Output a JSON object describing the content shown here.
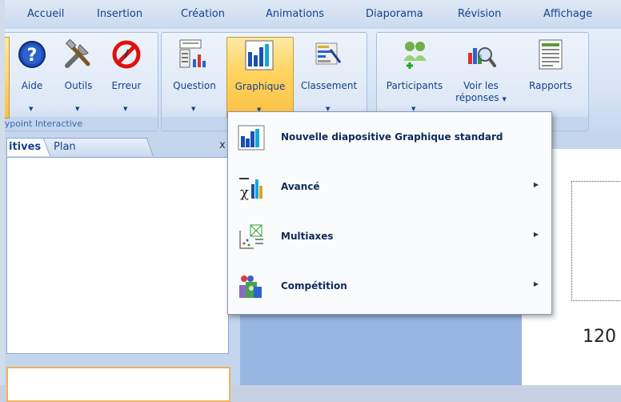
{
  "tabs": [
    "Accueil",
    "Insertion",
    "Création",
    "Animations",
    "Diaporama",
    "Révision",
    "Affichage"
  ],
  "ribbon": {
    "group1": {
      "label": "eypoint Interactive",
      "buttons": [
        {
          "label": "Aide",
          "icon": "help-icon"
        },
        {
          "label": "Outils",
          "icon": "tools-icon"
        },
        {
          "label": "Erreur",
          "icon": "error-icon"
        }
      ]
    },
    "group2": {
      "buttons": [
        {
          "label": "Question",
          "icon": "question-slide-icon"
        },
        {
          "label": "Graphique",
          "icon": "bar-chart-icon"
        },
        {
          "label": "Classement",
          "icon": "ranking-icon"
        }
      ]
    },
    "group3": {
      "buttons": [
        {
          "label": "Participants",
          "icon": "participants-icon"
        },
        {
          "label": "Voir les",
          "label2": "réponses",
          "icon": "view-responses-icon"
        },
        {
          "label": "Rapports",
          "icon": "reports-icon"
        }
      ]
    }
  },
  "panel": {
    "tab1": "itives",
    "tab2": "Plan",
    "close": "x"
  },
  "slide": {
    "number": "120"
  },
  "menu": {
    "items": [
      {
        "label": "Nouvelle diapositive Graphique standard",
        "icon": "standard-chart-icon",
        "submenu": false
      },
      {
        "label": "Avancé",
        "icon": "advanced-chart-icon",
        "submenu": true
      },
      {
        "label": "Multiaxes",
        "icon": "multiaxis-chart-icon",
        "submenu": true
      },
      {
        "label": "Compétition",
        "icon": "competition-icon",
        "submenu": true
      }
    ]
  }
}
